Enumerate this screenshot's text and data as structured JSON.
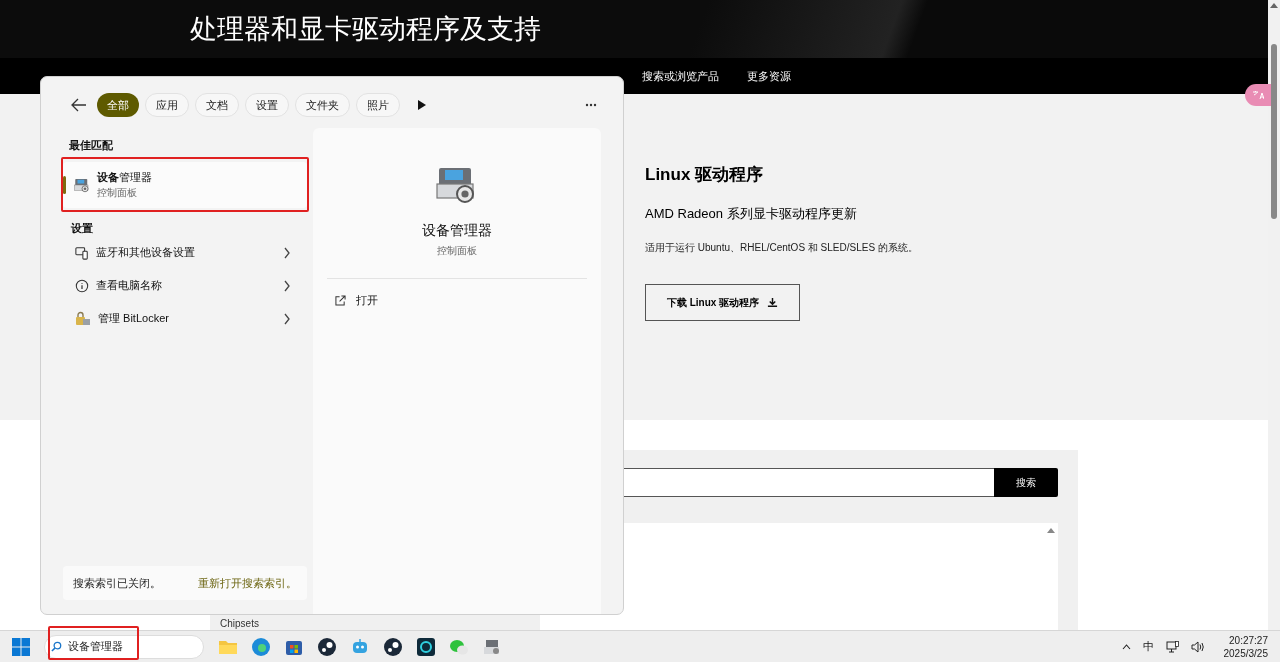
{
  "page": {
    "title": "处理器和显卡驱动程序及支持",
    "nav": [
      "搜索或浏览产品",
      "更多资源"
    ],
    "section": {
      "heading": "Linux 驱动程序",
      "subtitle": "AMD Radeon 系列显卡驱动程序更新",
      "description": "适用于运行 Ubuntu、RHEL/CentOS 和 SLED/SLES 的系统。",
      "button": "下载 Linux 驱动程序"
    },
    "search_button": "搜索",
    "list_fragment": "Chipsets"
  },
  "search_panel": {
    "filters": [
      {
        "label": "全部",
        "selected": true
      },
      {
        "label": "应用",
        "selected": false
      },
      {
        "label": "文档",
        "selected": false
      },
      {
        "label": "设置",
        "selected": false
      },
      {
        "label": "文件夹",
        "selected": false
      },
      {
        "label": "照片",
        "selected": false
      }
    ],
    "best_match_heading": "最佳匹配",
    "best_match": {
      "title": "**设备**管理器",
      "subtitle": "控制面板",
      "selected": true
    },
    "settings_heading": "设置",
    "settings_items": [
      {
        "label": "蓝牙和其他设备设置"
      },
      {
        "label": "查看电脑名称"
      },
      {
        "label": "管理 BitLocker"
      }
    ],
    "index_notice": {
      "text": "搜索索引已关闭。",
      "link": "重新打开搜索索引。"
    },
    "preview": {
      "title": "设备管理器",
      "subtitle": "控制面板",
      "actions": [
        {
          "label": "打开"
        }
      ]
    }
  },
  "taskbar": {
    "search_value": "设备管理器",
    "ime": "中",
    "time": "20:27:27",
    "date": "2025/3/25"
  }
}
